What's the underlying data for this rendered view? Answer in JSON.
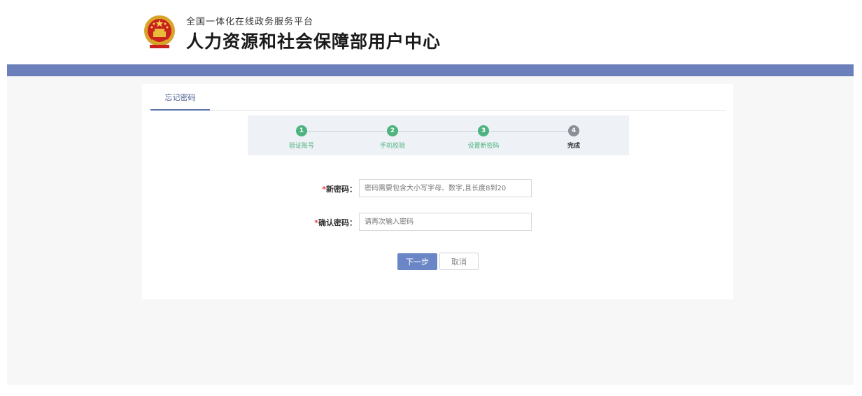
{
  "header": {
    "platform_name": "全国一体化在线政务服务平台",
    "site_title": "人力资源和社会保障部用户中心",
    "emblem_icon": "national-emblem-icon"
  },
  "tabs": [
    {
      "label": "忘记密码",
      "active": true
    }
  ],
  "steps": [
    {
      "number": "1",
      "label": "验证账号",
      "status": "done"
    },
    {
      "number": "2",
      "label": "手机校验",
      "status": "done"
    },
    {
      "number": "3",
      "label": "设置新密码",
      "status": "done"
    },
    {
      "number": "4",
      "label": "完成",
      "status": "todo"
    }
  ],
  "form": {
    "required_mark": "*",
    "new_password": {
      "label": "新密码：",
      "placeholder": "密码需要包含大小写字母、数字,且长度8到20",
      "value": ""
    },
    "confirm_password": {
      "label": "确认密码：",
      "placeholder": "请再次输入密码",
      "value": ""
    }
  },
  "buttons": {
    "next": "下一步",
    "cancel": "取消"
  },
  "colors": {
    "brand_bar": "#6b7fbb",
    "step_done": "#4db37f",
    "step_todo": "#8a8f98",
    "primary_button": "#6b86c6",
    "required": "#e5433a"
  }
}
